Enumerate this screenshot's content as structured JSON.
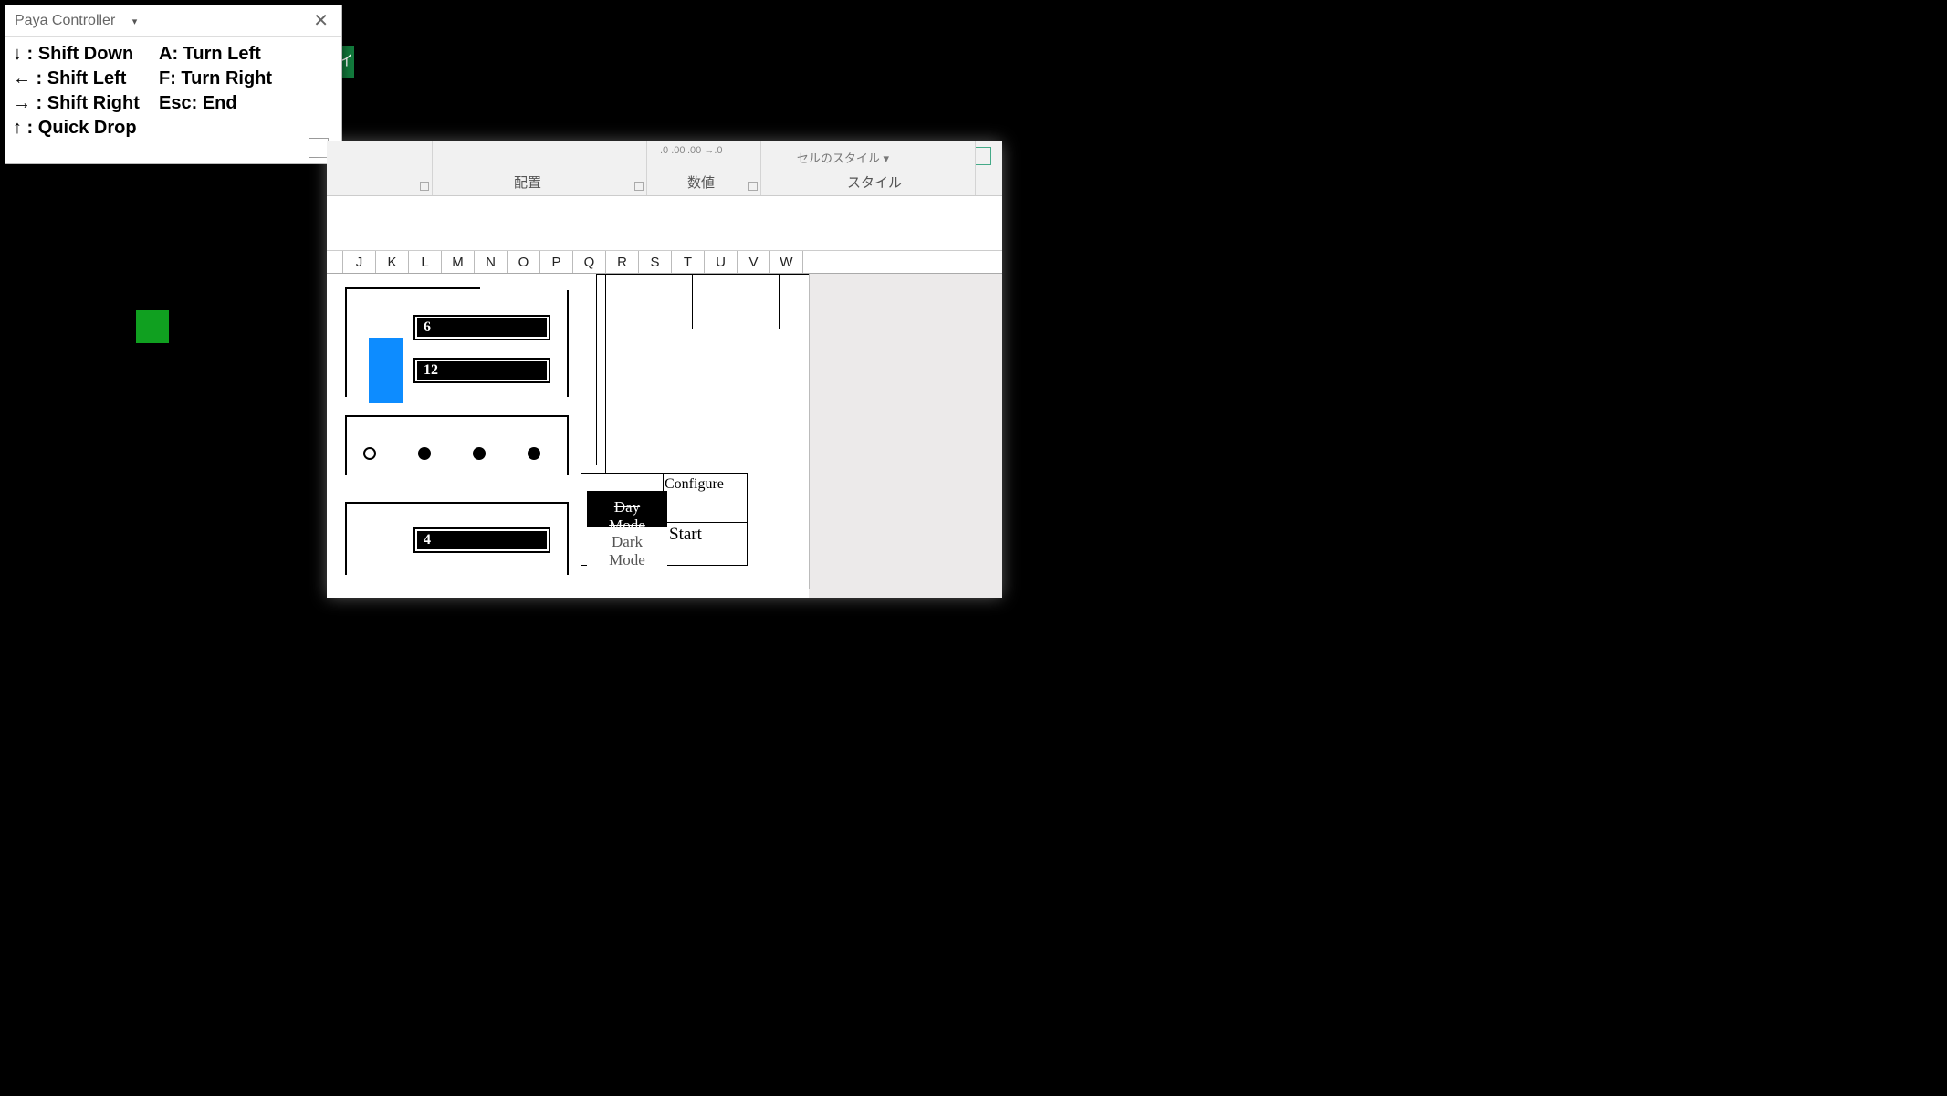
{
  "desktop": {
    "green_piece_name": "falling-piece"
  },
  "paya": {
    "title": "Paya Controller",
    "close_glyph": "✕",
    "col1": [
      "↓ : Shift Down",
      "← : Shift Left",
      "→ : Shift Right",
      "↑ : Quick Drop"
    ],
    "col2": [
      "A:  Turn Left",
      "F:  Turn Right",
      "",
      "Esc: End"
    ]
  },
  "excel": {
    "tab_sliver": "イ",
    "ribbon": {
      "groups": [
        "配置",
        "数値",
        "スタイル"
      ],
      "cell_styles_label": "セルのスタイル ▾",
      "dec1": ".0\n.00",
      "dec2": ".00\n→.0"
    },
    "columns": [
      "",
      "J",
      "K",
      "L",
      "M",
      "N",
      "O",
      "P",
      "Q",
      "R",
      "S",
      "T",
      "U",
      "V",
      "W"
    ],
    "values": {
      "bar1": "6",
      "bar2": "12",
      "bar3": "4"
    },
    "buttons": {
      "day_mode": "Day Mode",
      "dark_mode": "Dark Mode",
      "configure": "Configure",
      "start": "Start"
    }
  }
}
